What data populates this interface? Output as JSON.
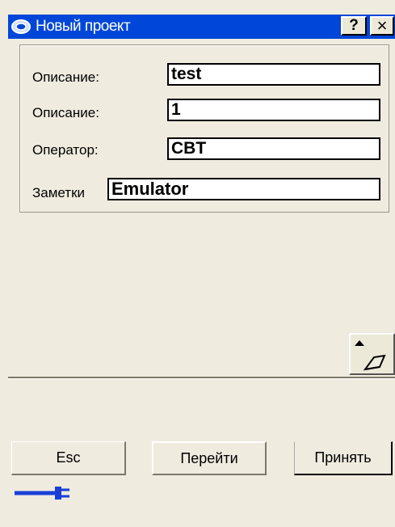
{
  "window": {
    "title": "Новый проект",
    "help_label": "?",
    "close_label": "×"
  },
  "form": {
    "fields": [
      {
        "label": "Описание:",
        "value": "test"
      },
      {
        "label": "Описание:",
        "value": "1"
      },
      {
        "label": "Оператор:",
        "value": "CBT"
      },
      {
        "label": "Заметки",
        "value": "Emulator"
      }
    ]
  },
  "buttons": {
    "esc": "Esc",
    "go": "Перейти",
    "accept": "Принять"
  },
  "icons": {
    "app": "app-logo-icon",
    "scroll": "scroll-up-arrow-icon",
    "connection": "plug-icon"
  },
  "colors": {
    "titlebar": "#0046d8",
    "background": "#efebdf",
    "plug": "#1a3fd8"
  }
}
